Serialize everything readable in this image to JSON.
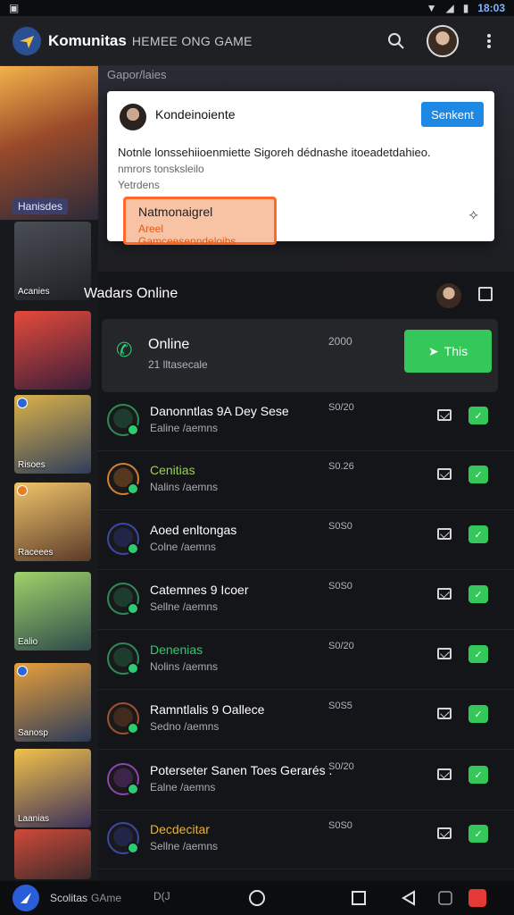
{
  "status_bar": {
    "time": "18:03"
  },
  "app": {
    "title": "Komunitas",
    "subtitle": "HEMEE ONG GAME"
  },
  "header": {
    "search_icon": "search-icon",
    "menu_icon": "overflow-menu-icon"
  },
  "sidebar": {
    "hero_caption": "Hanisdes",
    "items": [
      {
        "caption": "Acanies"
      },
      {
        "caption": ""
      },
      {
        "caption": "Risoes"
      },
      {
        "caption": "Raceees"
      },
      {
        "caption": "Ealio"
      },
      {
        "caption": "Sanosp"
      },
      {
        "caption": "Laanias"
      },
      {
        "caption": ""
      }
    ]
  },
  "section_hint": "Gapor/laies",
  "notification": {
    "name": "Kondeinoiente",
    "action_label": "Senkent",
    "line1": "Notnle lonssehiioenmiette Sigoreh dédnashe itoeadetdahieo.",
    "line2": "nmrors tonsksleilo",
    "line3": "Yetrdens",
    "chip_title": "Natmonaigrel",
    "chip_sub": "Areel Gamceesenndeloibs"
  },
  "leaders": {
    "section_title": "Wadars Online",
    "online_card": {
      "title": "Online",
      "subtitle": "21 lltasecale",
      "value": "2000",
      "button_label": "This"
    },
    "rows": [
      {
        "title": "Danonntlas 9A Dey Sese",
        "sub": "Ealine /aemns",
        "value": "S0/20",
        "avatar_color": "#2e8b57"
      },
      {
        "title": "Cenitias",
        "sub": "Nalins /aemns",
        "value": "S0.26",
        "avatar_color": "#d2802e",
        "title_color": "#9ad155"
      },
      {
        "title": "Aoed enltongas",
        "sub": "Colne /aemns",
        "value": "S0S0",
        "avatar_color": "#3a49a8"
      },
      {
        "title": "Catemnes 9 Icoer",
        "sub": "Sellne /aemns",
        "value": "S0S0",
        "avatar_color": "#2e8b57"
      },
      {
        "title": "Denenias",
        "sub": "Nolins /aemns",
        "value": "S0/20",
        "avatar_color": "#2e8b57",
        "title_color": "#2ecc71"
      },
      {
        "title": "Ramntlalis 9 Oallece",
        "sub": "Sedno /aemns",
        "value": "S0S5",
        "avatar_color": "#a0522d"
      },
      {
        "title": "Poterseter Sanen Toes Gerarés .",
        "sub": "Ealne /aemns",
        "value": "S0/20",
        "avatar_color": "#8e44ad"
      },
      {
        "title": "Decdecitar",
        "sub": "Sellne /aemns",
        "value": "S0S0",
        "avatar_color": "#3a49a8",
        "title_color": "#e7b33b"
      }
    ]
  },
  "navbar": {
    "label": "Scolitas",
    "label_dim": "GAme",
    "mid_text": "D(J"
  }
}
